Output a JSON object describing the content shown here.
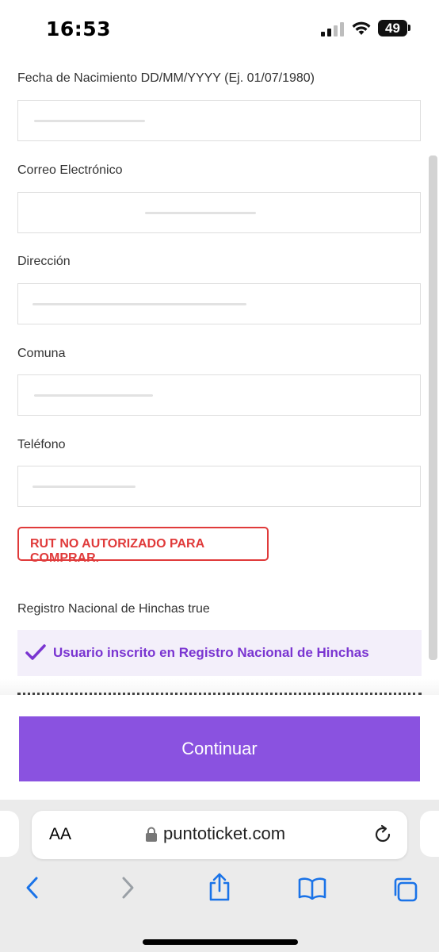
{
  "status": {
    "time": "16:53",
    "battery": "49"
  },
  "form": {
    "fields": [
      {
        "label": "Fecha de Nacimiento DD/MM/YYYY (Ej. 01/07/1980)"
      },
      {
        "label": "Correo Electrónico"
      },
      {
        "label": "Dirección"
      },
      {
        "label": "Comuna"
      },
      {
        "label": "Teléfono"
      }
    ],
    "error": "RUT NO AUTORIZADO PARA COMPRAR.",
    "rnh_label": "Registro Nacional de Hinchas true",
    "rnh_status": "Usuario inscrito en Registro Nacional de Hinchas"
  },
  "footer": {
    "continue_label": "Continuar"
  },
  "browser": {
    "aa_label": "AA",
    "url": "puntoticket.com"
  },
  "colors": {
    "accent": "#8a52e0",
    "error": "#e03a3a",
    "check": "#7a35d1"
  }
}
